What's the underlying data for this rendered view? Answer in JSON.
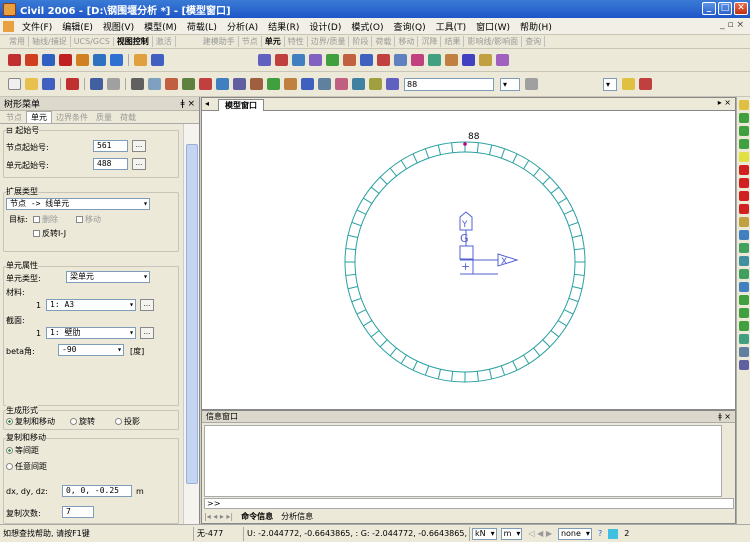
{
  "window": {
    "title": "Civil 2006 - [D:\\钢围堰分析 *] - [模型窗口]"
  },
  "menu": [
    "文件(F)",
    "编辑(E)",
    "视图(V)",
    "模型(M)",
    "荷载(L)",
    "分析(A)",
    "结果(R)",
    "设计(D)",
    "模式(O)",
    "查询(Q)",
    "工具(T)",
    "窗口(W)",
    "帮助(H)"
  ],
  "ribbon_tabs": [
    "常用",
    "轴线/捕捉",
    "UCS/GCS",
    "视图控制",
    "激活",
    "建模助手",
    "节点",
    "单元",
    "特性",
    "边界/质量",
    "阶段",
    "荷载",
    "移动",
    "沉降",
    "结果",
    "影响线/影响面",
    "查询"
  ],
  "ribbon_active_left": "视图控制",
  "ribbon_active_right": "单元",
  "toolbar": {
    "number_field": "88"
  },
  "tree_panel": {
    "title": "树形菜单",
    "tabs": [
      "节点",
      "单元",
      "边界条件",
      "质量",
      "荷载"
    ],
    "active_tab": "单元",
    "start_section": "起始号",
    "node_start_label": "节点起始号:",
    "node_start_value": "561",
    "elem_start_label": "单元起始号:",
    "elem_start_value": "488",
    "browse": "...",
    "ext_type_title": "扩展类型",
    "ext_type_value": "节点 -> 线单元",
    "target_label": "目标:",
    "delete_label": "删除",
    "move_label": "移动",
    "reverse_label": "反转I-J",
    "elem_attr_title": "单元属性",
    "elem_type_label": "单元类型:",
    "elem_type_value": "梁单元",
    "material_label": "材料:",
    "material_no": "1",
    "material_value": "1: A3",
    "section_label": "截面:",
    "section_no": "1",
    "section_value": "1: 壁肋",
    "beta_label": "beta角:",
    "beta_value": "-90",
    "beta_unit": "[度]",
    "gen_form_title": "生成形式",
    "gen_options": [
      "复制和移动",
      "旋转",
      "投影"
    ],
    "copy_move_title": "复制和移动",
    "spacing_options": [
      "等间距",
      "任意间距"
    ],
    "dxdydz_label": "dx, dy, dz:",
    "dxdydz_value": "0, 0, -0.25",
    "dxdydz_unit": "m",
    "copy_count_label": "复制次数:",
    "copy_count_value": "7"
  },
  "doc": {
    "tab": "模型窗口",
    "node_label": "88",
    "ucs_y": "Y",
    "ucs_g": "G",
    "ucs_x": "X",
    "ring_segments": 56
  },
  "info": {
    "title": "信息窗口",
    "prompt": ">>",
    "tabs": [
      "命令信息",
      "分析信息"
    ]
  },
  "status": {
    "help": "如想查找帮助, 请按F1键",
    "elem": "无-477",
    "coords": "U: -2.044772, -0.6643865, : G: -2.044772, -0.6643865, :",
    "unit_force": "kN",
    "unit_len": "m",
    "unit_none": "none",
    "page": "2"
  },
  "colors": {
    "title": "#2a5fd0",
    "ring": "#2aa0a0",
    "ucs": "#5060d0",
    "node": "#c00080"
  }
}
